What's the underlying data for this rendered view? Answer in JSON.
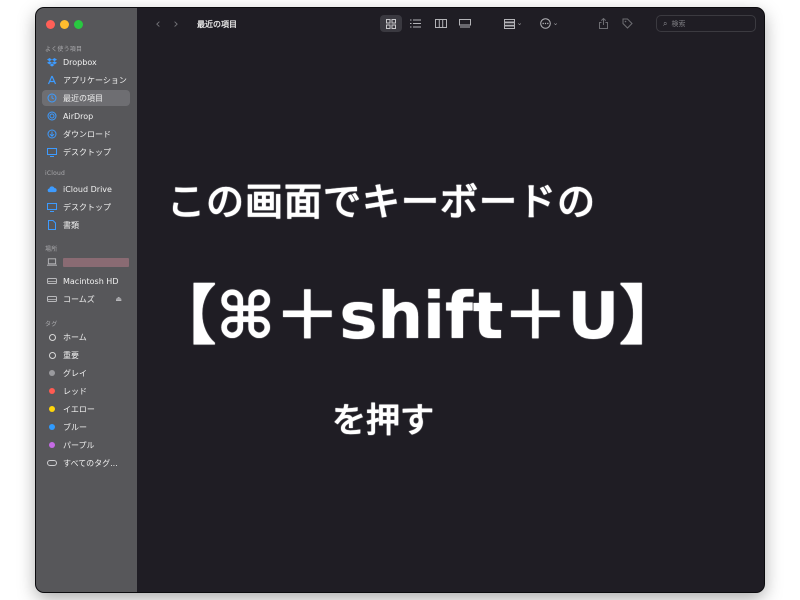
{
  "window": {
    "title": "最近の項目"
  },
  "sidebar": {
    "sections": [
      {
        "label": "よく使う項目",
        "items": [
          {
            "label": "Dropbox",
            "icon": "dropbox-icon"
          },
          {
            "label": "アプリケーション",
            "icon": "applications-icon"
          },
          {
            "label": "最近の項目",
            "icon": "clock-icon",
            "selected": true
          },
          {
            "label": "AirDrop",
            "icon": "airdrop-icon"
          },
          {
            "label": "ダウンロード",
            "icon": "download-icon"
          },
          {
            "label": "デスクトップ",
            "icon": "desktop-icon"
          }
        ]
      },
      {
        "label": "iCloud",
        "items": [
          {
            "label": "iCloud Drive",
            "icon": "cloud-icon"
          },
          {
            "label": "デスクトップ",
            "icon": "desktop-icon"
          },
          {
            "label": "書類",
            "icon": "document-icon"
          }
        ]
      },
      {
        "label": "場所",
        "items": [
          {
            "label": "",
            "icon": "laptop-icon"
          },
          {
            "label": "Macintosh HD",
            "icon": "disk-icon"
          },
          {
            "label": "コームズ",
            "icon": "network-disk-icon"
          }
        ]
      },
      {
        "label": "タグ",
        "items": [
          {
            "label": "ホーム",
            "color": ""
          },
          {
            "label": "重要",
            "color": ""
          },
          {
            "label": "グレイ",
            "color": "#9a9a9e"
          },
          {
            "label": "レッド",
            "color": "#ff5b52"
          },
          {
            "label": "イエロー",
            "color": "#ffd60a"
          },
          {
            "label": "ブルー",
            "color": "#2f9bff"
          },
          {
            "label": "パープル",
            "color": "#c66be6"
          },
          {
            "label": "すべてのタグ...",
            "color": ""
          }
        ]
      }
    ]
  },
  "toolbar": {
    "search_placeholder": "検索"
  },
  "overlay": {
    "line1": "この画面でキーボードの",
    "line2": "【⌘＋shift＋U】",
    "line3": "を押す"
  },
  "colors": {
    "sidebar_bg": "#57575a",
    "content_bg": "#1f1d24",
    "accent": "#3d9bff"
  }
}
